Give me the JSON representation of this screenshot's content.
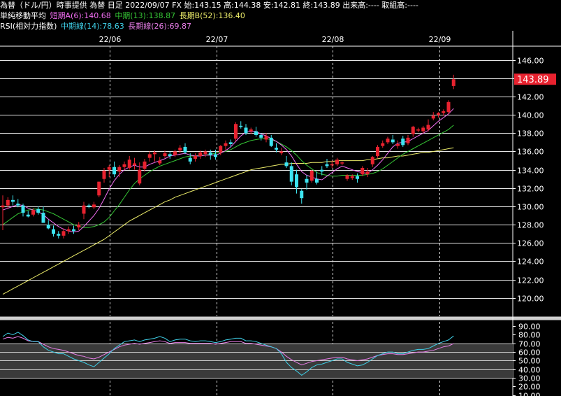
{
  "header": {
    "line1": "為替（ドル/円）時事提供 為替 日足 2022/09/07 FX 始:143.15 高:144.38 安:142.81 終:143.89 出来高:---- 取組高:----",
    "ma_label": "単純移動平均",
    "ma_short": "短期A(6):140.68",
    "ma_mid": "中期(13):138.87",
    "ma_long": "長期B(52):136.40",
    "rsi_label": "RSI(相対力指数)",
    "rsi_mid": "中期線(14):78.63",
    "rsi_long": "長期線(26):69.87"
  },
  "colors": {
    "background": "#000000",
    "candle_up": "#e8222f",
    "candle_down": "#3de4f0",
    "ma_short": "#f26ef2",
    "ma_mid": "#36c836",
    "ma_long": "#ecec6a",
    "rsi_mid": "#3fd0e8",
    "rsi_long": "#e87ee8",
    "price_tag": "#e8222f"
  },
  "chart_data": {
    "type": "candlestick",
    "x_labels": [
      "22/06",
      "22/07",
      "22/08",
      "22/09"
    ],
    "price_axis": {
      "ticks": [
        120,
        122,
        124,
        126,
        128,
        130,
        132,
        134,
        136,
        138,
        140,
        142,
        144,
        146
      ],
      "ylim": [
        118,
        147.5
      ]
    },
    "last_price_label": "143.89",
    "candles": [
      {
        "o": 129.9,
        "h": 131.2,
        "l": 127.4,
        "c": 130.1
      },
      {
        "o": 130.1,
        "h": 131.0,
        "l": 129.8,
        "c": 130.7
      },
      {
        "o": 130.7,
        "h": 131.2,
        "l": 130.1,
        "c": 130.5
      },
      {
        "o": 130.3,
        "h": 130.8,
        "l": 129.9,
        "c": 130.1
      },
      {
        "o": 130.1,
        "h": 130.3,
        "l": 128.9,
        "c": 129.3
      },
      {
        "o": 129.1,
        "h": 129.5,
        "l": 128.8,
        "c": 128.9
      },
      {
        "o": 129.1,
        "h": 129.8,
        "l": 128.9,
        "c": 129.6
      },
      {
        "o": 129.7,
        "h": 130.0,
        "l": 129.1,
        "c": 129.3
      },
      {
        "o": 129.3,
        "h": 130.0,
        "l": 128.4,
        "c": 128.2
      },
      {
        "o": 128.0,
        "h": 128.5,
        "l": 127.5,
        "c": 127.6
      },
      {
        "o": 127.5,
        "h": 127.9,
        "l": 126.7,
        "c": 127.0
      },
      {
        "o": 127.0,
        "h": 127.3,
        "l": 126.5,
        "c": 126.8
      },
      {
        "o": 126.8,
        "h": 127.6,
        "l": 126.5,
        "c": 127.3
      },
      {
        "o": 127.3,
        "h": 127.8,
        "l": 127.0,
        "c": 127.5
      },
      {
        "o": 127.5,
        "h": 127.9,
        "l": 127.0,
        "c": 127.3
      },
      {
        "o": 127.7,
        "h": 128.3,
        "l": 127.4,
        "c": 128.0
      },
      {
        "o": 129.2,
        "h": 130.5,
        "l": 128.6,
        "c": 130.1
      },
      {
        "o": 130.1,
        "h": 130.3,
        "l": 129.8,
        "c": 130.0
      },
      {
        "o": 129.9,
        "h": 130.5,
        "l": 129.7,
        "c": 130.2
      },
      {
        "o": 131.2,
        "h": 132.7,
        "l": 131.0,
        "c": 132.7
      },
      {
        "o": 133.0,
        "h": 134.2,
        "l": 132.6,
        "c": 133.9
      },
      {
        "o": 134.0,
        "h": 134.5,
        "l": 133.2,
        "c": 134.3
      },
      {
        "o": 134.3,
        "h": 134.9,
        "l": 133.2,
        "c": 133.5
      },
      {
        "o": 133.8,
        "h": 134.5,
        "l": 133.2,
        "c": 134.3
      },
      {
        "o": 134.3,
        "h": 134.9,
        "l": 134.0,
        "c": 134.6
      },
      {
        "o": 134.2,
        "h": 135.5,
        "l": 134.0,
        "c": 135.1
      },
      {
        "o": 134.5,
        "h": 135.3,
        "l": 134.0,
        "c": 134.7
      },
      {
        "o": 132.5,
        "h": 134.8,
        "l": 132.3,
        "c": 134.0
      },
      {
        "o": 134.1,
        "h": 135.2,
        "l": 133.8,
        "c": 134.9
      },
      {
        "o": 135.3,
        "h": 136.0,
        "l": 134.9,
        "c": 135.7
      },
      {
        "o": 135.7,
        "h": 136.1,
        "l": 134.9,
        "c": 135.9
      },
      {
        "o": 134.7,
        "h": 135.4,
        "l": 134.5,
        "c": 135.0
      },
      {
        "o": 135.5,
        "h": 136.1,
        "l": 135.3,
        "c": 135.8
      },
      {
        "o": 135.7,
        "h": 136.0,
        "l": 135.2,
        "c": 135.5
      },
      {
        "o": 135.6,
        "h": 136.2,
        "l": 135.4,
        "c": 136.0
      },
      {
        "o": 136.1,
        "h": 136.7,
        "l": 135.8,
        "c": 136.4
      },
      {
        "o": 136.5,
        "h": 136.9,
        "l": 135.7,
        "c": 135.9
      },
      {
        "o": 135.3,
        "h": 135.8,
        "l": 134.6,
        "c": 134.9
      },
      {
        "o": 135.2,
        "h": 135.8,
        "l": 134.9,
        "c": 135.5
      },
      {
        "o": 135.5,
        "h": 136.1,
        "l": 135.2,
        "c": 135.9
      },
      {
        "o": 135.7,
        "h": 136.2,
        "l": 135.4,
        "c": 136.0
      },
      {
        "o": 135.9,
        "h": 136.2,
        "l": 135.1,
        "c": 135.6
      },
      {
        "o": 135.7,
        "h": 136.2,
        "l": 135.1,
        "c": 135.4
      },
      {
        "o": 135.9,
        "h": 136.7,
        "l": 135.6,
        "c": 136.6
      },
      {
        "o": 136.6,
        "h": 137.2,
        "l": 136.2,
        "c": 136.9
      },
      {
        "o": 137.0,
        "h": 137.3,
        "l": 136.5,
        "c": 136.8
      },
      {
        "o": 137.4,
        "h": 139.2,
        "l": 137.1,
        "c": 139.0
      },
      {
        "o": 138.8,
        "h": 139.3,
        "l": 138.5,
        "c": 138.7
      },
      {
        "o": 138.6,
        "h": 139.0,
        "l": 137.8,
        "c": 138.0
      },
      {
        "o": 138.2,
        "h": 138.6,
        "l": 137.9,
        "c": 138.4
      },
      {
        "o": 138.2,
        "h": 138.7,
        "l": 137.6,
        "c": 137.8
      },
      {
        "o": 137.8,
        "h": 138.0,
        "l": 137.2,
        "c": 137.5
      },
      {
        "o": 137.3,
        "h": 138.0,
        "l": 137.0,
        "c": 137.7
      },
      {
        "o": 137.5,
        "h": 137.8,
        "l": 136.5,
        "c": 136.6
      },
      {
        "o": 136.4,
        "h": 136.9,
        "l": 135.9,
        "c": 136.2
      },
      {
        "o": 135.8,
        "h": 136.4,
        "l": 135.6,
        "c": 136.0
      },
      {
        "o": 134.8,
        "h": 135.5,
        "l": 134.2,
        "c": 134.4
      },
      {
        "o": 134.4,
        "h": 134.8,
        "l": 132.3,
        "c": 132.7
      },
      {
        "o": 133.5,
        "h": 134.0,
        "l": 131.4,
        "c": 132.1
      },
      {
        "o": 131.7,
        "h": 131.9,
        "l": 130.3,
        "c": 130.9
      },
      {
        "o": 133.0,
        "h": 133.4,
        "l": 131.8,
        "c": 132.6
      },
      {
        "o": 132.8,
        "h": 134.0,
        "l": 132.6,
        "c": 133.9
      },
      {
        "o": 133.0,
        "h": 133.8,
        "l": 132.4,
        "c": 132.6
      },
      {
        "o": 134.0,
        "h": 134.4,
        "l": 133.4,
        "c": 133.8
      },
      {
        "o": 134.6,
        "h": 135.2,
        "l": 134.2,
        "c": 134.4
      },
      {
        "o": 134.5,
        "h": 135.0,
        "l": 134.2,
        "c": 134.6
      },
      {
        "o": 134.6,
        "h": 135.3,
        "l": 134.4,
        "c": 135.1
      },
      {
        "o": 134.7,
        "h": 134.9,
        "l": 134.5,
        "c": 134.8
      },
      {
        "o": 133.0,
        "h": 133.5,
        "l": 132.8,
        "c": 133.4
      },
      {
        "o": 133.1,
        "h": 133.5,
        "l": 132.9,
        "c": 133.3
      },
      {
        "o": 133.3,
        "h": 133.6,
        "l": 132.6,
        "c": 133.0
      },
      {
        "o": 133.5,
        "h": 134.4,
        "l": 133.3,
        "c": 134.2
      },
      {
        "o": 133.5,
        "h": 134.2,
        "l": 133.2,
        "c": 133.8
      },
      {
        "o": 134.6,
        "h": 135.5,
        "l": 134.3,
        "c": 135.4
      },
      {
        "o": 135.5,
        "h": 136.7,
        "l": 135.3,
        "c": 136.5
      },
      {
        "o": 136.6,
        "h": 137.2,
        "l": 136.4,
        "c": 136.9
      },
      {
        "o": 137.0,
        "h": 137.6,
        "l": 136.8,
        "c": 137.4
      },
      {
        "o": 137.3,
        "h": 137.8,
        "l": 136.8,
        "c": 137.0
      },
      {
        "o": 136.6,
        "h": 137.2,
        "l": 136.3,
        "c": 136.8
      },
      {
        "o": 137.4,
        "h": 137.7,
        "l": 136.5,
        "c": 136.7
      },
      {
        "o": 136.9,
        "h": 137.8,
        "l": 136.7,
        "c": 137.5
      },
      {
        "o": 137.9,
        "h": 138.8,
        "l": 137.6,
        "c": 138.7
      },
      {
        "o": 138.3,
        "h": 138.6,
        "l": 138.1,
        "c": 138.4
      },
      {
        "o": 138.2,
        "h": 138.8,
        "l": 138.0,
        "c": 138.6
      },
      {
        "o": 138.4,
        "h": 139.5,
        "l": 138.2,
        "c": 138.9
      },
      {
        "o": 139.6,
        "h": 140.3,
        "l": 139.4,
        "c": 139.9
      },
      {
        "o": 140.0,
        "h": 140.3,
        "l": 139.7,
        "c": 140.2
      },
      {
        "o": 140.2,
        "h": 140.6,
        "l": 139.9,
        "c": 140.4
      },
      {
        "o": 140.3,
        "h": 141.6,
        "l": 140.1,
        "c": 141.4
      },
      {
        "o": 143.15,
        "h": 144.38,
        "l": 142.81,
        "c": 143.89
      }
    ],
    "ma_short": [
      129.6,
      129.8,
      130.0,
      130.2,
      130.1,
      129.8,
      129.6,
      129.4,
      129.1,
      128.6,
      128.2,
      127.8,
      127.5,
      127.3,
      127.2,
      127.3,
      127.8,
      128.4,
      129.0,
      129.8,
      130.8,
      131.9,
      132.8,
      133.5,
      134.0,
      134.3,
      134.5,
      134.3,
      134.3,
      134.6,
      134.8,
      135.0,
      135.2,
      135.5,
      135.6,
      135.7,
      135.8,
      135.6,
      135.5,
      135.5,
      135.6,
      135.6,
      135.6,
      135.8,
      136.1,
      136.5,
      137.1,
      137.7,
      138.1,
      138.2,
      138.2,
      137.9,
      137.7,
      137.4,
      137.1,
      136.7,
      136.2,
      135.5,
      134.6,
      133.8,
      133.4,
      133.2,
      133.0,
      132.9,
      133.3,
      133.7,
      134.1,
      134.4,
      134.2,
      134.0,
      133.8,
      133.7,
      133.6,
      134.0,
      134.5,
      135.1,
      135.8,
      136.5,
      136.9,
      137.0,
      137.1,
      137.4,
      137.7,
      138.0,
      138.3,
      138.8,
      139.3,
      139.7,
      140.1,
      140.68
    ],
    "ma_mid": [
      128.0,
      128.4,
      128.8,
      129.2,
      129.4,
      129.6,
      129.7,
      129.7,
      129.6,
      129.4,
      129.2,
      128.9,
      128.6,
      128.3,
      128.0,
      127.8,
      127.7,
      127.7,
      127.8,
      128.0,
      128.3,
      128.8,
      129.5,
      130.2,
      131.0,
      131.8,
      132.5,
      133.0,
      133.4,
      133.8,
      134.1,
      134.4,
      134.6,
      134.8,
      135.0,
      135.2,
      135.4,
      135.5,
      135.5,
      135.6,
      135.6,
      135.7,
      135.8,
      135.9,
      136.0,
      136.2,
      136.5,
      136.8,
      137.0,
      137.2,
      137.3,
      137.4,
      137.4,
      137.3,
      137.1,
      136.8,
      136.5,
      136.1,
      135.6,
      135.0,
      134.5,
      134.1,
      133.7,
      133.5,
      133.4,
      133.3,
      133.3,
      133.4,
      133.4,
      133.4,
      133.4,
      133.4,
      133.5,
      133.6,
      133.8,
      134.1,
      134.5,
      134.9,
      135.3,
      135.7,
      136.0,
      136.3,
      136.6,
      136.9,
      137.2,
      137.5,
      137.8,
      138.1,
      138.4,
      138.87
    ],
    "ma_long": [
      120.4,
      120.7,
      121.0,
      121.3,
      121.6,
      121.9,
      122.2,
      122.5,
      122.8,
      123.1,
      123.4,
      123.7,
      124.0,
      124.3,
      124.6,
      124.9,
      125.2,
      125.5,
      125.8,
      126.1,
      126.4,
      126.8,
      127.2,
      127.6,
      128.0,
      128.4,
      128.7,
      129.0,
      129.3,
      129.6,
      129.9,
      130.2,
      130.5,
      130.7,
      131.0,
      131.2,
      131.4,
      131.6,
      131.8,
      132.0,
      132.2,
      132.4,
      132.6,
      132.8,
      133.0,
      133.2,
      133.4,
      133.6,
      133.8,
      134.0,
      134.1,
      134.2,
      134.3,
      134.4,
      134.5,
      134.6,
      134.6,
      134.7,
      134.7,
      134.7,
      134.7,
      134.8,
      134.8,
      134.8,
      134.9,
      134.9,
      135.0,
      135.0,
      135.0,
      135.0,
      135.0,
      135.0,
      135.1,
      135.1,
      135.2,
      135.3,
      135.3,
      135.4,
      135.5,
      135.5,
      135.6,
      135.7,
      135.8,
      135.9,
      135.9,
      136.0,
      136.1,
      136.2,
      136.3,
      136.4
    ],
    "rsi_axis": {
      "ticks": [
        10,
        20,
        30,
        40,
        50,
        60,
        70,
        80,
        90
      ],
      "ylim": [
        9,
        95
      ]
    },
    "rsi_mid": [
      78,
      82,
      80,
      83,
      79,
      74,
      72,
      72,
      66,
      62,
      60,
      58,
      58,
      55,
      52,
      50,
      48,
      45,
      43,
      48,
      53,
      58,
      64,
      68,
      72,
      73,
      74,
      72,
      74,
      75,
      76,
      78,
      76,
      72,
      74,
      75,
      75,
      73,
      72,
      73,
      73,
      72,
      71,
      72,
      74,
      75,
      76,
      76,
      73,
      73,
      72,
      70,
      68,
      66,
      64,
      58,
      48,
      42,
      38,
      33,
      37,
      42,
      45,
      46,
      48,
      50,
      52,
      52,
      48,
      46,
      44,
      45,
      48,
      52,
      56,
      58,
      60,
      60,
      58,
      58,
      60,
      62,
      63,
      63,
      64,
      67,
      70,
      72,
      74,
      78.63
    ],
    "rsi_long": [
      75,
      77,
      76,
      78,
      76,
      73,
      72,
      72,
      69,
      66,
      64,
      63,
      62,
      60,
      58,
      56,
      55,
      53,
      52,
      54,
      57,
      60,
      63,
      66,
      68,
      69,
      70,
      69,
      70,
      71,
      72,
      73,
      72,
      70,
      71,
      71,
      71,
      70,
      70,
      70,
      70,
      70,
      69,
      70,
      71,
      72,
      72,
      72,
      70,
      70,
      69,
      68,
      67,
      66,
      64,
      60,
      55,
      51,
      48,
      45,
      47,
      49,
      50,
      51,
      52,
      53,
      54,
      54,
      52,
      51,
      50,
      51,
      52,
      54,
      56,
      57,
      58,
      58,
      57,
      57,
      58,
      59,
      60,
      60,
      61,
      62,
      64,
      66,
      67,
      69.87
    ]
  }
}
